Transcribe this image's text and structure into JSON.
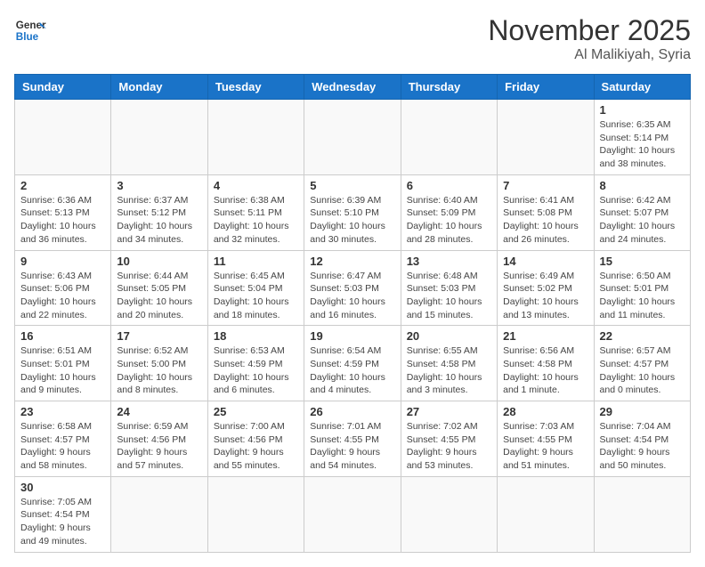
{
  "logo": {
    "general": "General",
    "blue": "Blue"
  },
  "title": "November 2025",
  "location": "Al Malikiyah, Syria",
  "weekdays": [
    "Sunday",
    "Monday",
    "Tuesday",
    "Wednesday",
    "Thursday",
    "Friday",
    "Saturday"
  ],
  "weeks": [
    [
      {
        "day": "",
        "info": ""
      },
      {
        "day": "",
        "info": ""
      },
      {
        "day": "",
        "info": ""
      },
      {
        "day": "",
        "info": ""
      },
      {
        "day": "",
        "info": ""
      },
      {
        "day": "",
        "info": ""
      },
      {
        "day": "1",
        "info": "Sunrise: 6:35 AM\nSunset: 5:14 PM\nDaylight: 10 hours and 38 minutes."
      }
    ],
    [
      {
        "day": "2",
        "info": "Sunrise: 6:36 AM\nSunset: 5:13 PM\nDaylight: 10 hours and 36 minutes."
      },
      {
        "day": "3",
        "info": "Sunrise: 6:37 AM\nSunset: 5:12 PM\nDaylight: 10 hours and 34 minutes."
      },
      {
        "day": "4",
        "info": "Sunrise: 6:38 AM\nSunset: 5:11 PM\nDaylight: 10 hours and 32 minutes."
      },
      {
        "day": "5",
        "info": "Sunrise: 6:39 AM\nSunset: 5:10 PM\nDaylight: 10 hours and 30 minutes."
      },
      {
        "day": "6",
        "info": "Sunrise: 6:40 AM\nSunset: 5:09 PM\nDaylight: 10 hours and 28 minutes."
      },
      {
        "day": "7",
        "info": "Sunrise: 6:41 AM\nSunset: 5:08 PM\nDaylight: 10 hours and 26 minutes."
      },
      {
        "day": "8",
        "info": "Sunrise: 6:42 AM\nSunset: 5:07 PM\nDaylight: 10 hours and 24 minutes."
      }
    ],
    [
      {
        "day": "9",
        "info": "Sunrise: 6:43 AM\nSunset: 5:06 PM\nDaylight: 10 hours and 22 minutes."
      },
      {
        "day": "10",
        "info": "Sunrise: 6:44 AM\nSunset: 5:05 PM\nDaylight: 10 hours and 20 minutes."
      },
      {
        "day": "11",
        "info": "Sunrise: 6:45 AM\nSunset: 5:04 PM\nDaylight: 10 hours and 18 minutes."
      },
      {
        "day": "12",
        "info": "Sunrise: 6:47 AM\nSunset: 5:03 PM\nDaylight: 10 hours and 16 minutes."
      },
      {
        "day": "13",
        "info": "Sunrise: 6:48 AM\nSunset: 5:03 PM\nDaylight: 10 hours and 15 minutes."
      },
      {
        "day": "14",
        "info": "Sunrise: 6:49 AM\nSunset: 5:02 PM\nDaylight: 10 hours and 13 minutes."
      },
      {
        "day": "15",
        "info": "Sunrise: 6:50 AM\nSunset: 5:01 PM\nDaylight: 10 hours and 11 minutes."
      }
    ],
    [
      {
        "day": "16",
        "info": "Sunrise: 6:51 AM\nSunset: 5:01 PM\nDaylight: 10 hours and 9 minutes."
      },
      {
        "day": "17",
        "info": "Sunrise: 6:52 AM\nSunset: 5:00 PM\nDaylight: 10 hours and 8 minutes."
      },
      {
        "day": "18",
        "info": "Sunrise: 6:53 AM\nSunset: 4:59 PM\nDaylight: 10 hours and 6 minutes."
      },
      {
        "day": "19",
        "info": "Sunrise: 6:54 AM\nSunset: 4:59 PM\nDaylight: 10 hours and 4 minutes."
      },
      {
        "day": "20",
        "info": "Sunrise: 6:55 AM\nSunset: 4:58 PM\nDaylight: 10 hours and 3 minutes."
      },
      {
        "day": "21",
        "info": "Sunrise: 6:56 AM\nSunset: 4:58 PM\nDaylight: 10 hours and 1 minute."
      },
      {
        "day": "22",
        "info": "Sunrise: 6:57 AM\nSunset: 4:57 PM\nDaylight: 10 hours and 0 minutes."
      }
    ],
    [
      {
        "day": "23",
        "info": "Sunrise: 6:58 AM\nSunset: 4:57 PM\nDaylight: 9 hours and 58 minutes."
      },
      {
        "day": "24",
        "info": "Sunrise: 6:59 AM\nSunset: 4:56 PM\nDaylight: 9 hours and 57 minutes."
      },
      {
        "day": "25",
        "info": "Sunrise: 7:00 AM\nSunset: 4:56 PM\nDaylight: 9 hours and 55 minutes."
      },
      {
        "day": "26",
        "info": "Sunrise: 7:01 AM\nSunset: 4:55 PM\nDaylight: 9 hours and 54 minutes."
      },
      {
        "day": "27",
        "info": "Sunrise: 7:02 AM\nSunset: 4:55 PM\nDaylight: 9 hours and 53 minutes."
      },
      {
        "day": "28",
        "info": "Sunrise: 7:03 AM\nSunset: 4:55 PM\nDaylight: 9 hours and 51 minutes."
      },
      {
        "day": "29",
        "info": "Sunrise: 7:04 AM\nSunset: 4:54 PM\nDaylight: 9 hours and 50 minutes."
      }
    ],
    [
      {
        "day": "30",
        "info": "Sunrise: 7:05 AM\nSunset: 4:54 PM\nDaylight: 9 hours and 49 minutes."
      },
      {
        "day": "",
        "info": ""
      },
      {
        "day": "",
        "info": ""
      },
      {
        "day": "",
        "info": ""
      },
      {
        "day": "",
        "info": ""
      },
      {
        "day": "",
        "info": ""
      },
      {
        "day": "",
        "info": ""
      }
    ]
  ]
}
